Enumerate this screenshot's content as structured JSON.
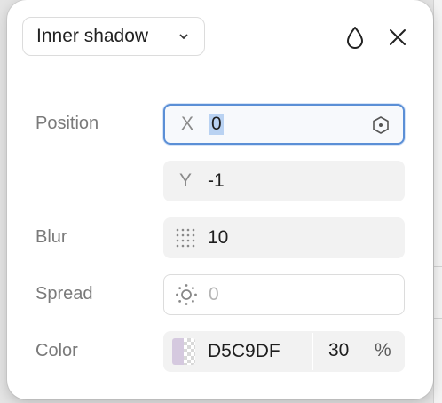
{
  "header": {
    "effect_type": "Inner shadow",
    "dropdown_icon": "chevron-down-icon",
    "visibility_icon": "drop-icon",
    "close_icon": "close-icon"
  },
  "position": {
    "label": "Position",
    "x_prefix": "X",
    "x_value": "0",
    "y_prefix": "Y",
    "y_value": "-1",
    "constraint_icon": "hexagon-dot-icon"
  },
  "blur": {
    "label": "Blur",
    "icon": "blur-dots-icon",
    "value": "10"
  },
  "spread": {
    "label": "Spread",
    "icon": "spread-sun-icon",
    "value": "0"
  },
  "color": {
    "label": "Color",
    "hex": "D5C9DF",
    "swatch": "#D5C9DF",
    "opacity": "30",
    "percent": "%"
  },
  "colors": {
    "focus_accent": "#5b8fd6",
    "selection": "#b9d2f2",
    "field_bg": "#f2f2f2"
  }
}
